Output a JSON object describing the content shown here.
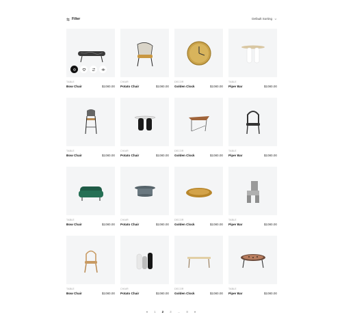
{
  "toolbar": {
    "filter_label": "Filter",
    "sorting_label": "Default Sorting"
  },
  "products": [
    {
      "category": "TABLE",
      "name": "Bow Chair",
      "price": "$1080.00",
      "icon": "marble-bench"
    },
    {
      "category": "CHAIR",
      "name": "Potato Chair",
      "price": "$1080.00",
      "icon": "lounge-chair"
    },
    {
      "category": "DECOR",
      "name": "Golden Clock",
      "price": "$1080.00",
      "icon": "wall-clock"
    },
    {
      "category": "TABLE",
      "name": "Piper Bar",
      "price": "$1080.00",
      "icon": "round-side-table"
    },
    {
      "category": "TABLE",
      "name": "Bow Chair",
      "price": "$1080.00",
      "icon": "bar-stool"
    },
    {
      "category": "CHAIR",
      "name": "Potato Chair",
      "price": "$1080.00",
      "icon": "black-side-table"
    },
    {
      "category": "DECOR",
      "name": "Golden Clock",
      "price": "$1080.00",
      "icon": "wire-table"
    },
    {
      "category": "TABLE",
      "name": "Piper Bar",
      "price": "$1080.00",
      "icon": "black-chair"
    },
    {
      "category": "TABLE",
      "name": "Bow Chair",
      "price": "$1080.00",
      "icon": "green-sofa"
    },
    {
      "category": "CHAIR",
      "name": "Potato Chair",
      "price": "$1080.00",
      "icon": "stone-table"
    },
    {
      "category": "DECOR",
      "name": "Golden Clock",
      "price": "$1080.00",
      "icon": "gold-tray"
    },
    {
      "category": "TABLE",
      "name": "Piper Bar",
      "price": "$1080.00",
      "icon": "grey-block-chair"
    },
    {
      "category": "TABLE",
      "name": "Bow Chair",
      "price": "$1080.00",
      "icon": "wooden-chair"
    },
    {
      "category": "CHAIR",
      "name": "Potato Chair",
      "price": "$1080.00",
      "icon": "vases"
    },
    {
      "category": "DECOR",
      "name": "Golden Clock",
      "price": "$1080.00",
      "icon": "wood-coffee-table"
    },
    {
      "category": "TABLE",
      "name": "Piper Bar",
      "price": "$1080.00",
      "icon": "mosaic-table"
    }
  ],
  "first_card_actions": [
    "cart-icon",
    "heart-icon",
    "compare-icon",
    "eye-icon"
  ],
  "pagination": {
    "prev": "«",
    "pages": [
      "1",
      "2",
      "3",
      "...",
      "8"
    ],
    "active": "2",
    "next": "»"
  },
  "colors": {
    "card_bg": "#f4f5f6",
    "accent": "#111111"
  }
}
